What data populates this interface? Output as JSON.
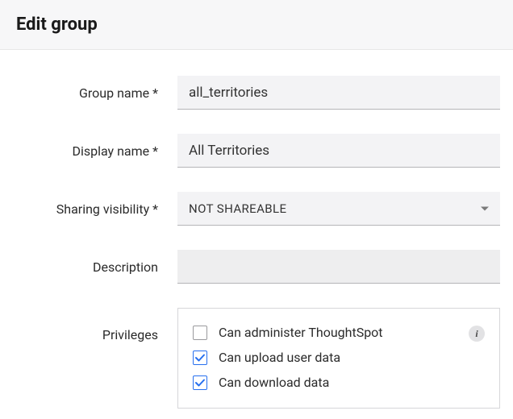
{
  "header": {
    "title": "Edit group"
  },
  "form": {
    "group_name": {
      "label": "Group name *",
      "value": "all_territories"
    },
    "display_name": {
      "label": "Display name *",
      "value": "All Territories"
    },
    "sharing_visibility": {
      "label": "Sharing visibility *",
      "selected": "NOT SHAREABLE"
    },
    "description": {
      "label": "Description",
      "value": ""
    },
    "privileges": {
      "label": "Privileges",
      "items": [
        {
          "label": "Can administer ThoughtSpot",
          "checked": false,
          "has_info": true
        },
        {
          "label": "Can upload user data",
          "checked": true,
          "has_info": false
        },
        {
          "label": "Can download data",
          "checked": true,
          "has_info": false
        }
      ]
    }
  }
}
